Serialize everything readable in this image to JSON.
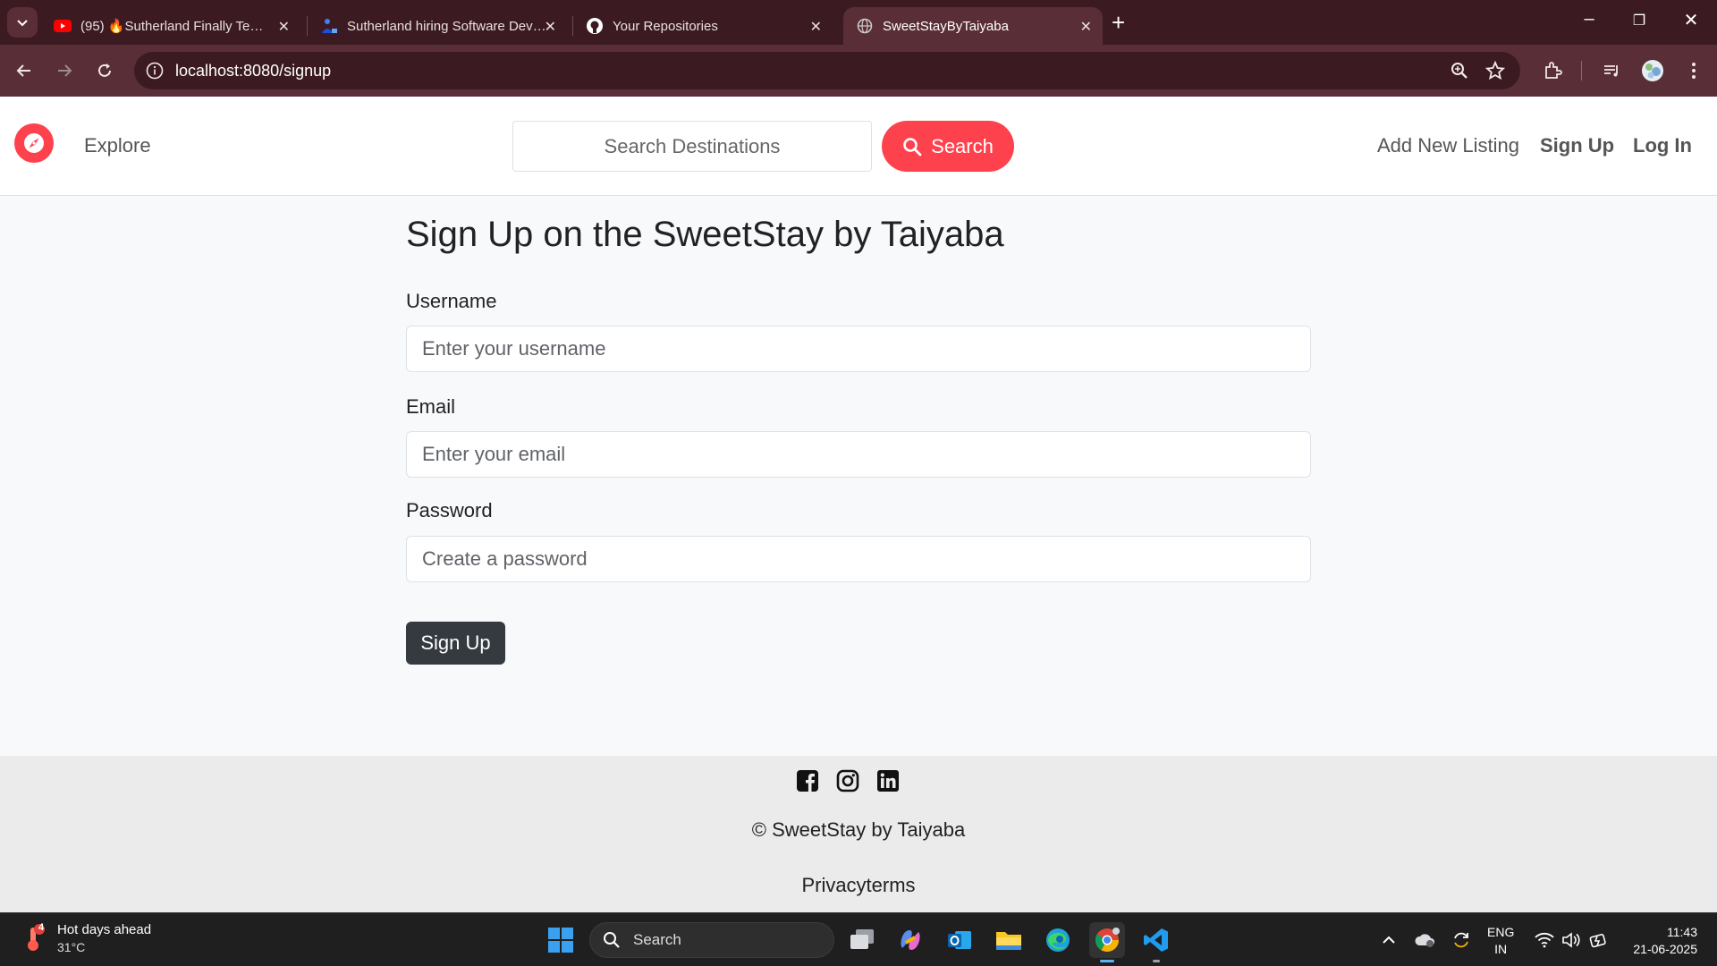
{
  "browser": {
    "tabs": [
      {
        "title": "(95) 🔥Sutherland Finally Tech Hiring",
        "icon": "youtube-icon"
      },
      {
        "title": "Sutherland hiring Software Developer",
        "icon": "job-icon"
      },
      {
        "title": "Your Repositories",
        "icon": "github-icon"
      },
      {
        "title": "SweetStayByTaiyaba",
        "icon": "globe-icon"
      }
    ],
    "url": "localhost:8080/signup"
  },
  "site": {
    "nav": {
      "explore": "Explore",
      "search_placeholder": "Search Destinations",
      "search_button": "Search",
      "add_listing": "Add New Listing",
      "signup": "Sign Up",
      "login": "Log In"
    },
    "form": {
      "title": "Sign Up on the SweetStay by Taiyaba",
      "username_label": "Username",
      "username_placeholder": "Enter your username",
      "email_label": "Email",
      "email_placeholder": "Enter your email",
      "password_label": "Password",
      "password_placeholder": "Create a password",
      "submit": "Sign Up"
    },
    "footer": {
      "social_icons": [
        "facebook-icon",
        "instagram-icon",
        "linkedin-icon"
      ],
      "copyright": "© SweetStay by Taiyaba",
      "links": "Privacyterms"
    },
    "colors": {
      "brand": "#fe424d",
      "button_dark": "#343a40"
    }
  },
  "taskbar": {
    "weather_title": "Hot days ahead",
    "weather_temp": "31°C",
    "weather_badge": "4",
    "search_label": "Search",
    "lang_line1": "ENG",
    "lang_line2": "IN",
    "time": "11:43",
    "date": "21-06-2025"
  }
}
